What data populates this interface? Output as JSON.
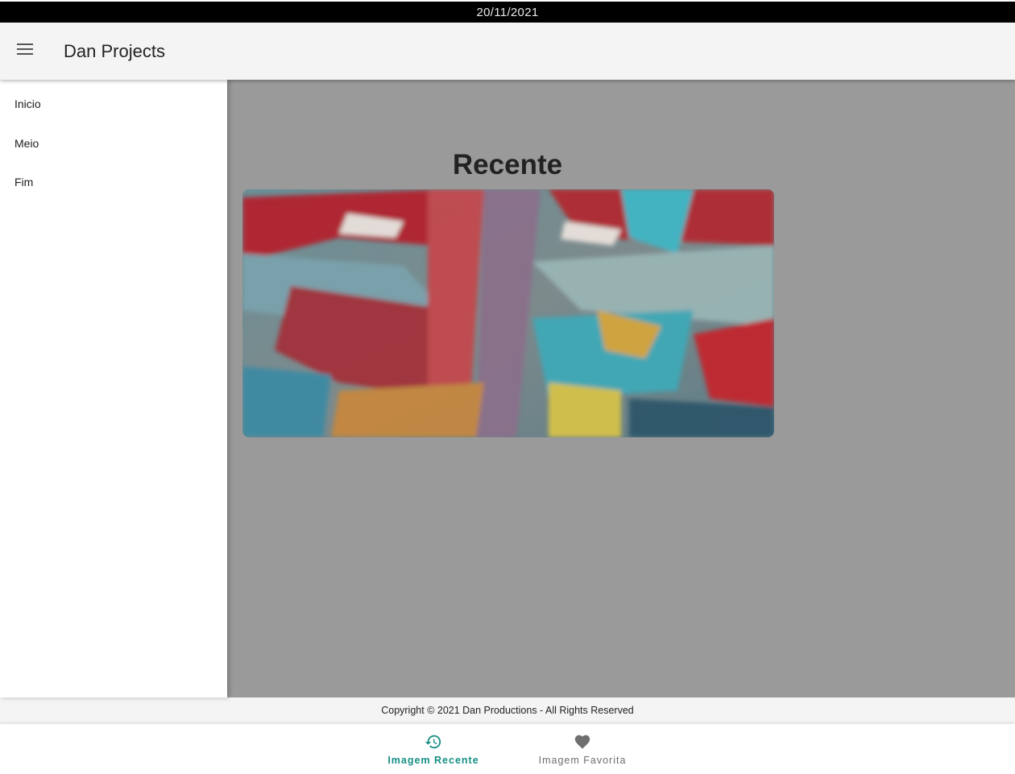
{
  "status_bar": {
    "date": "20/11/2021"
  },
  "app_bar": {
    "title": "Dan Projects",
    "menu_icon": "menu-icon"
  },
  "drawer": {
    "items": [
      {
        "label": "Inicio"
      },
      {
        "label": "Meio"
      },
      {
        "label": "Fim"
      }
    ]
  },
  "main": {
    "section_title": "Recente"
  },
  "footer": {
    "text": "Copyright © 2021 Dan Productions - All Rights Reserved"
  },
  "bottom_nav": {
    "items": [
      {
        "label": "Imagem Recente",
        "icon": "history-icon",
        "active": true
      },
      {
        "label": "Imagem Favorita",
        "icon": "heart-icon",
        "active": false
      }
    ]
  },
  "colors": {
    "accent": "#168f85",
    "inactive": "#6f6f6f",
    "scrim": "#9a9a9a",
    "app_bar": "#f4f4f4"
  }
}
